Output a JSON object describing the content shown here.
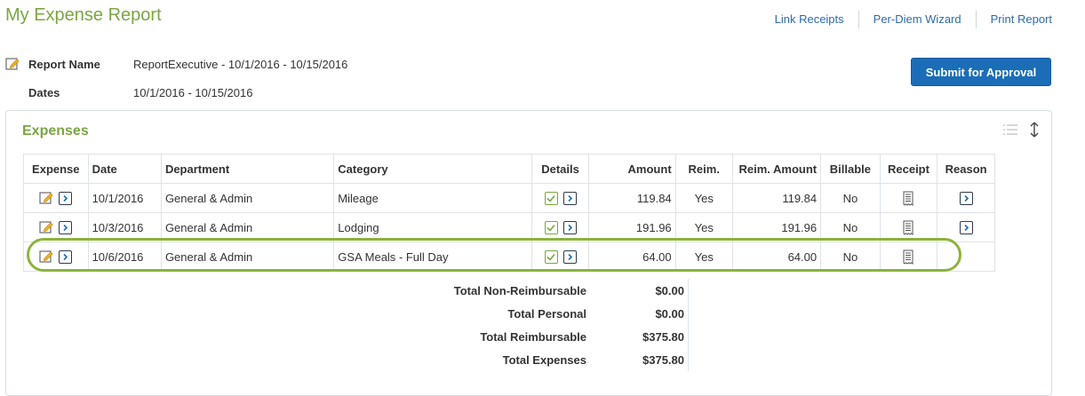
{
  "page": {
    "title": "My Expense Report"
  },
  "links": [
    "Link Receipts",
    "Per-Diem Wizard",
    "Print Report"
  ],
  "report": {
    "name_label": "Report Name",
    "name_value": "ReportExecutive - 10/1/2016 - 10/15/2016",
    "dates_label": "Dates",
    "dates_value": "10/1/2016 - 10/15/2016",
    "edit_icon": "pencil-edit-icon"
  },
  "submit_label": "Submit for Approval",
  "expenses": {
    "title": "Expenses",
    "tool_icons": [
      "list-icon",
      "expand-collapse-icon"
    ],
    "columns": [
      "Expense",
      "Date",
      "Department",
      "Category",
      "Details",
      "Amount",
      "Reim.",
      "Reim. Amount",
      "Billable",
      "Receipt",
      "Reason"
    ],
    "rows": [
      {
        "date": "10/1/2016",
        "department": "General & Admin",
        "category": "Mileage",
        "amount": "119.84",
        "reim": "Yes",
        "reim_amount": "119.84",
        "billable": "No",
        "has_reason": true
      },
      {
        "date": "10/3/2016",
        "department": "General & Admin",
        "category": "Lodging",
        "amount": "191.96",
        "reim": "Yes",
        "reim_amount": "191.96",
        "billable": "No",
        "has_reason": true
      },
      {
        "date": "10/6/2016",
        "department": "General & Admin",
        "category": "GSA Meals - Full Day",
        "amount": "64.00",
        "reim": "Yes",
        "reim_amount": "64.00",
        "billable": "No",
        "has_reason": false,
        "highlighted": true
      }
    ]
  },
  "totals": [
    {
      "label": "Total Non-Reimbursable",
      "value": "$0.00"
    },
    {
      "label": "Total Personal",
      "value": "$0.00"
    },
    {
      "label": "Total Reimbursable",
      "value": "$375.80"
    },
    {
      "label": "Total Expenses",
      "value": "$375.80"
    }
  ],
  "colors": {
    "title_green": "#7aa640",
    "link_blue": "#2e6aa8",
    "button_blue": "#1b6db7",
    "highlight_green": "#8cb33c"
  }
}
